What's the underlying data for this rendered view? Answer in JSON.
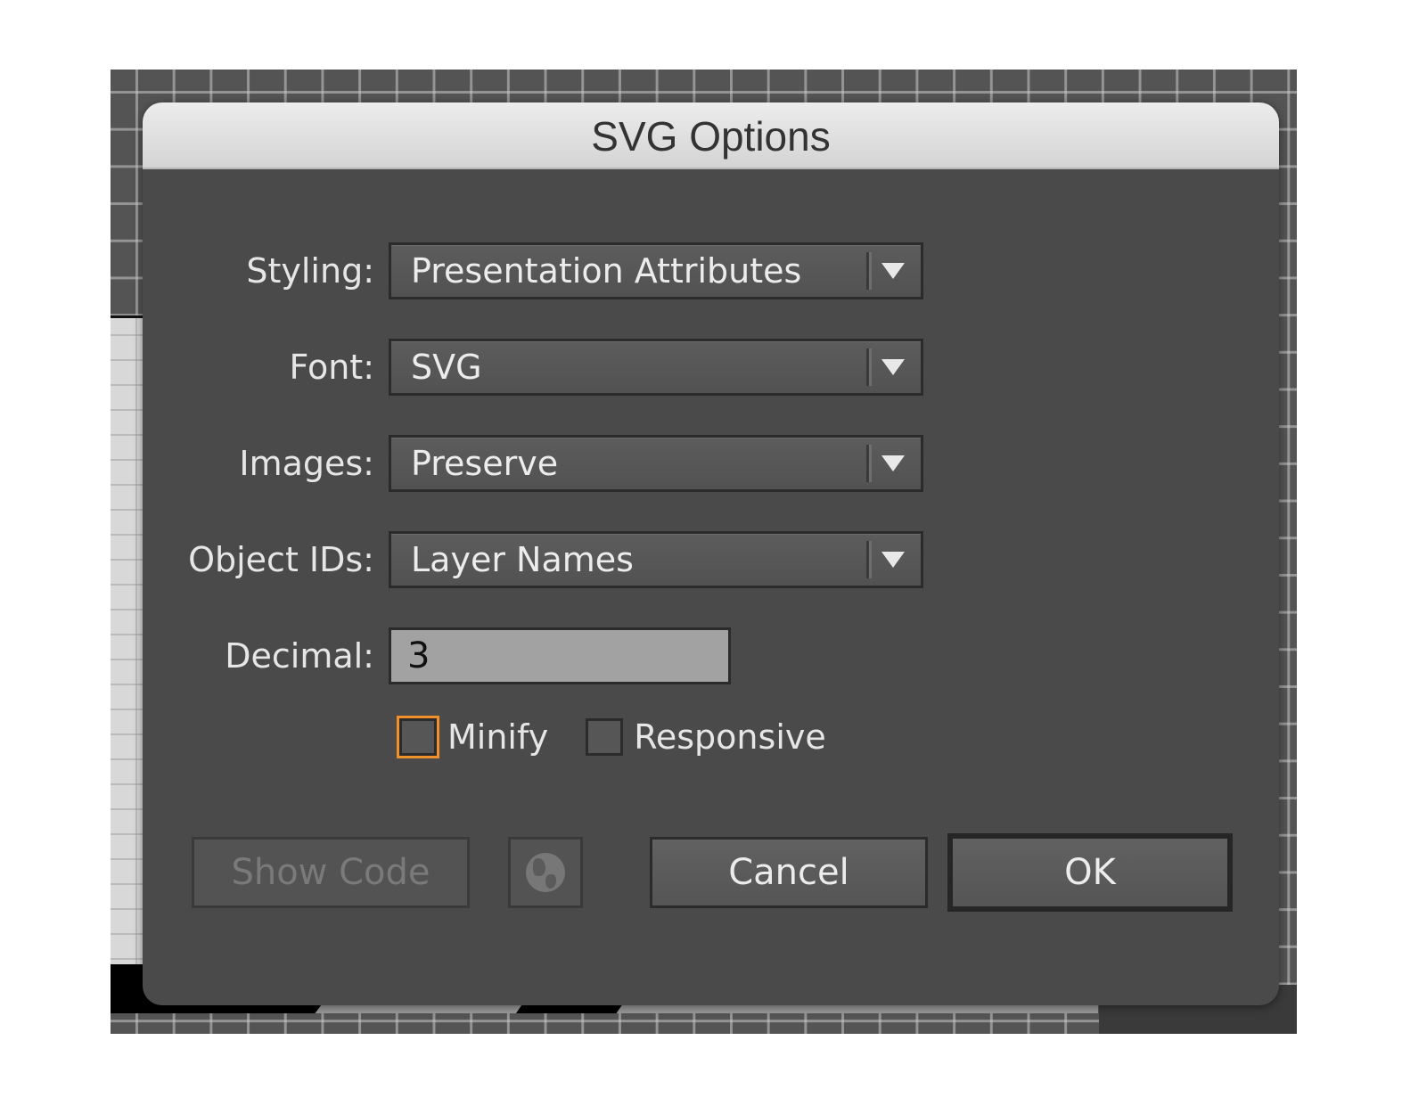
{
  "dialog": {
    "title": "SVG Options",
    "fields": [
      {
        "label": "Styling:",
        "value": "Presentation Attributes",
        "type": "select"
      },
      {
        "label": "Font:",
        "value": "SVG",
        "type": "select"
      },
      {
        "label": "Images:",
        "value": "Preserve",
        "type": "select"
      },
      {
        "label": "Object IDs:",
        "value": "Layer Names",
        "type": "select"
      }
    ],
    "decimal": {
      "label": "Decimal:",
      "value": "3"
    },
    "checkboxes": [
      {
        "label": "Minify",
        "checked": false,
        "focused": true
      },
      {
        "label": "Responsive",
        "checked": false,
        "focused": false
      }
    ],
    "buttons": {
      "show_code": "Show Code",
      "web_icon": "globe-icon",
      "cancel": "Cancel",
      "ok": "OK"
    }
  },
  "colors": {
    "focus_ring": "#f0902a",
    "dialog_bg": "#4a4a4a"
  }
}
